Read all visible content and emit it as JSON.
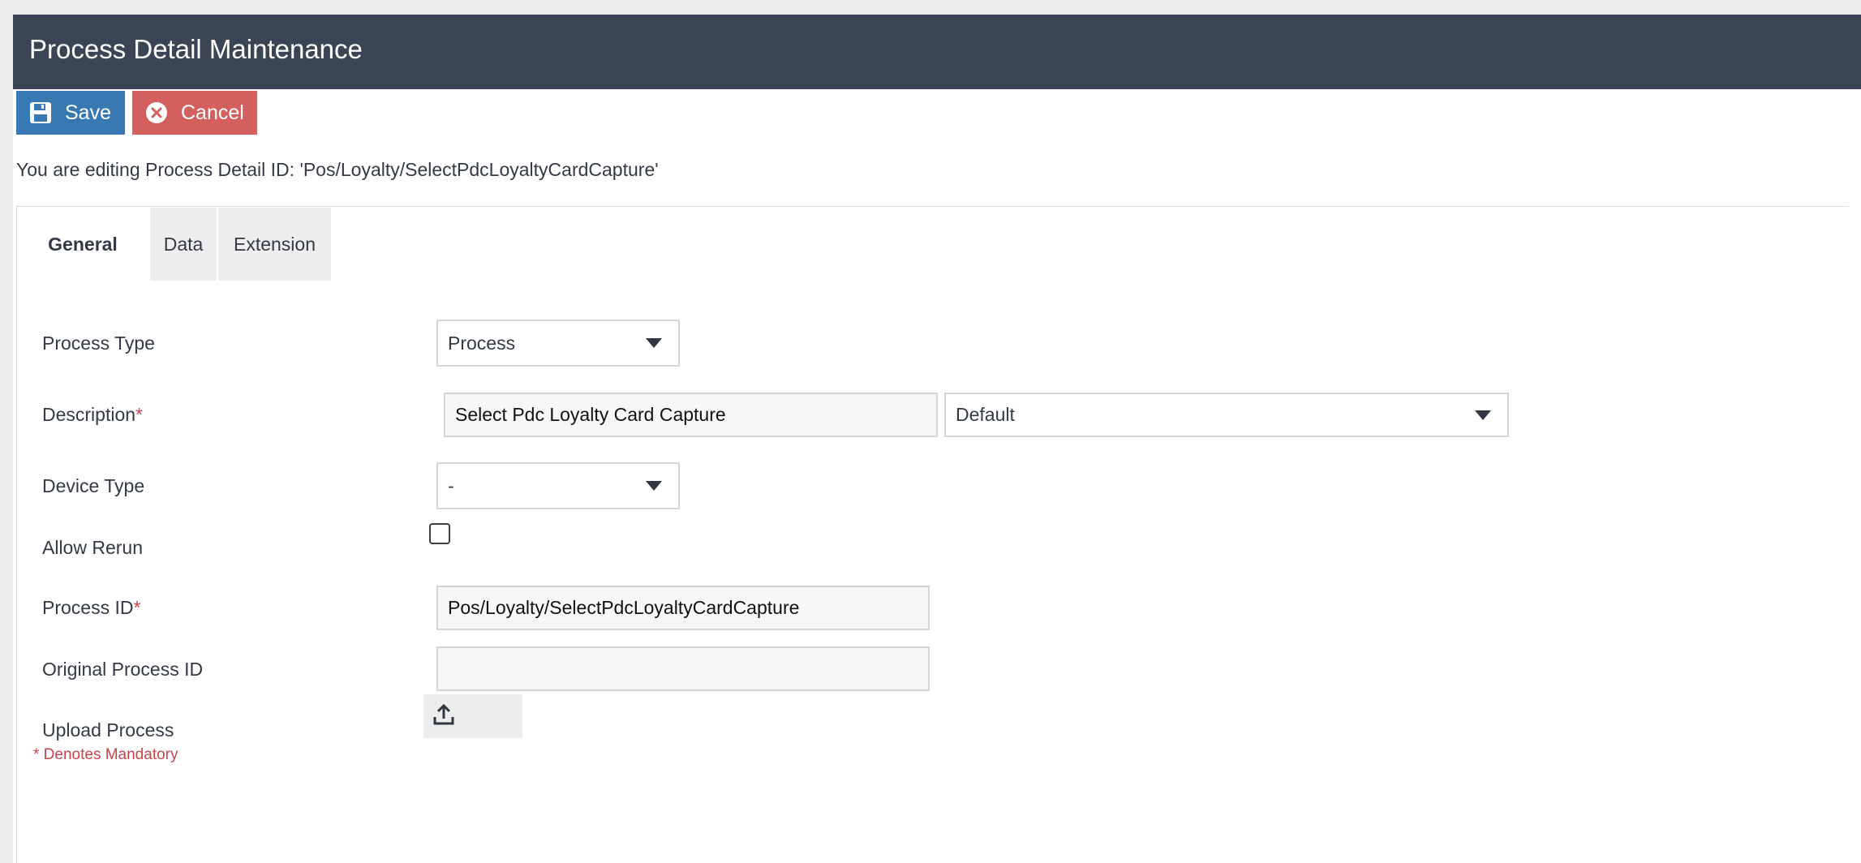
{
  "header": {
    "title": "Process Detail Maintenance"
  },
  "toolbar": {
    "save_label": "Save",
    "cancel_label": "Cancel",
    "save_icon": "floppy-disk-icon",
    "cancel_icon": "circle-x-icon"
  },
  "editing_message": "You are editing Process Detail ID: 'Pos/Loyalty/SelectPdcLoyaltyCardCapture'",
  "tabs": [
    {
      "label": "General",
      "active": true
    },
    {
      "label": "Data",
      "active": false
    },
    {
      "label": "Extension",
      "active": false
    }
  ],
  "form": {
    "process_type": {
      "label": "Process Type",
      "value": "Process"
    },
    "description": {
      "label": "Description",
      "required_mark": "*",
      "value": "Select Pdc Loyalty Card Capture",
      "locale_value": "Default"
    },
    "device_type": {
      "label": "Device Type",
      "value": "-"
    },
    "allow_rerun": {
      "label": "Allow Rerun",
      "checked": false
    },
    "process_id": {
      "label": "Process ID",
      "required_mark": "*",
      "value": "Pos/Loyalty/SelectPdcLoyaltyCardCapture"
    },
    "original_process_id": {
      "label": "Original Process ID",
      "value": ""
    },
    "upload_process": {
      "label": "Upload Process",
      "icon": "upload-icon"
    }
  },
  "mandatory_note": "* Denotes Mandatory",
  "colors": {
    "header_bg": "#3a4655",
    "save_bg": "#3879b4",
    "cancel_bg": "#d35f5f",
    "required": "#c9434c"
  }
}
